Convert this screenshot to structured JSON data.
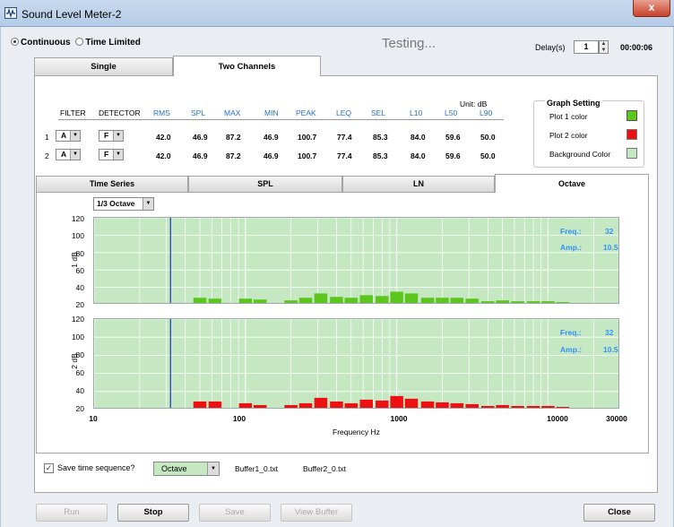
{
  "window": {
    "title": "Sound Level Meter-2",
    "close": "x"
  },
  "mode": {
    "continuous": "Continuous",
    "time_limited": "Time Limited",
    "status": "Testing..."
  },
  "delay": {
    "label": "Delay(s)",
    "value": "1",
    "timer": "00:00:06"
  },
  "tabs": {
    "single": "Single",
    "two_channels": "Two Channels"
  },
  "stats": {
    "unit": "Unit: dB",
    "headers": [
      "FILTER",
      "DETECTOR",
      "RMS",
      "SPL",
      "MAX",
      "MIN",
      "PEAK",
      "LEQ",
      "SEL",
      "L10",
      "L50",
      "L90"
    ],
    "rows": [
      {
        "num": "1",
        "filter": "A",
        "detector": "F",
        "values": [
          "42.0",
          "46.9",
          "87.2",
          "46.9",
          "100.7",
          "77.4",
          "85.3",
          "84.0",
          "59.6",
          "50.0"
        ]
      },
      {
        "num": "2",
        "filter": "A",
        "detector": "F",
        "values": [
          "42.0",
          "46.9",
          "87.2",
          "46.9",
          "100.7",
          "77.4",
          "85.3",
          "84.0",
          "59.6",
          "50.0"
        ]
      }
    ]
  },
  "graph_setting": {
    "title": "Graph Setting",
    "plot1": "Plot 1 color",
    "plot2": "Plot 2 color",
    "background": "Background Color",
    "plot1_color": "#5cc61f",
    "plot2_color": "#ee1111",
    "bg_color": "#c5e8c2"
  },
  "view_tabs": [
    "Time Series",
    "SPL",
    "LN",
    "Octave"
  ],
  "octave_select": "1/3 Octave",
  "plots": [
    {
      "ylabel": "1 dB",
      "yticks": [
        "120",
        "100",
        "80",
        "60",
        "40",
        "20"
      ],
      "freq_label": "Freq.:",
      "freq_value": "32",
      "amp_label": "Amp.:",
      "amp_value": "10.5"
    },
    {
      "ylabel": "2 dB",
      "yticks": [
        "120",
        "100",
        "80",
        "60",
        "40",
        "20"
      ],
      "freq_label": "Freq.:",
      "freq_value": "32",
      "amp_label": "Amp.:",
      "amp_value": "10.5"
    }
  ],
  "xaxis": {
    "ticks": [
      "10",
      "100",
      "1000",
      "10000",
      "30000"
    ],
    "label": "Frequency Hz"
  },
  "chart_data": {
    "type": "bar",
    "x_scale": "log",
    "xlim": [
      10,
      30000
    ],
    "ylim": [
      20,
      120
    ],
    "cursor_x": 32,
    "grid": true,
    "x": [
      16,
      20,
      25,
      31.5,
      40,
      50,
      63,
      80,
      100,
      125,
      160,
      200,
      250,
      315,
      400,
      500,
      630,
      800,
      1000,
      1250,
      1600,
      2000,
      2500,
      3150,
      4000,
      5000,
      6300,
      8000,
      10000,
      12500,
      16000,
      20000
    ],
    "series": [
      {
        "color": "#5cc61f",
        "values": [
          21.5,
          21.5,
          21.5,
          21.5,
          21.5,
          28,
          27,
          21.5,
          27,
          26,
          21.5,
          25,
          28,
          33,
          29,
          28,
          31,
          30,
          35,
          33,
          28,
          28,
          28,
          27,
          24,
          25,
          24,
          24,
          24,
          23,
          21.5,
          21.5
        ]
      },
      {
        "color": "#ee1111",
        "values": [
          21.5,
          21.5,
          21.5,
          21.5,
          21.5,
          29,
          29,
          21.5,
          27,
          25,
          21.5,
          25,
          27,
          33,
          29,
          27,
          31,
          30,
          35,
          32,
          29,
          28,
          27,
          26,
          24,
          25,
          24,
          24,
          24,
          23,
          21.5,
          21.5
        ]
      }
    ]
  },
  "bottom": {
    "save_label": "Save time sequence?",
    "buffer_type": "Octave",
    "buffer1": "Buffer1_0.txt",
    "buffer2": "Buffer2_0.txt"
  },
  "buttons": {
    "run": "Run",
    "stop": "Stop",
    "save": "Save",
    "view_buffer": "View Buffer",
    "close": "Close"
  }
}
